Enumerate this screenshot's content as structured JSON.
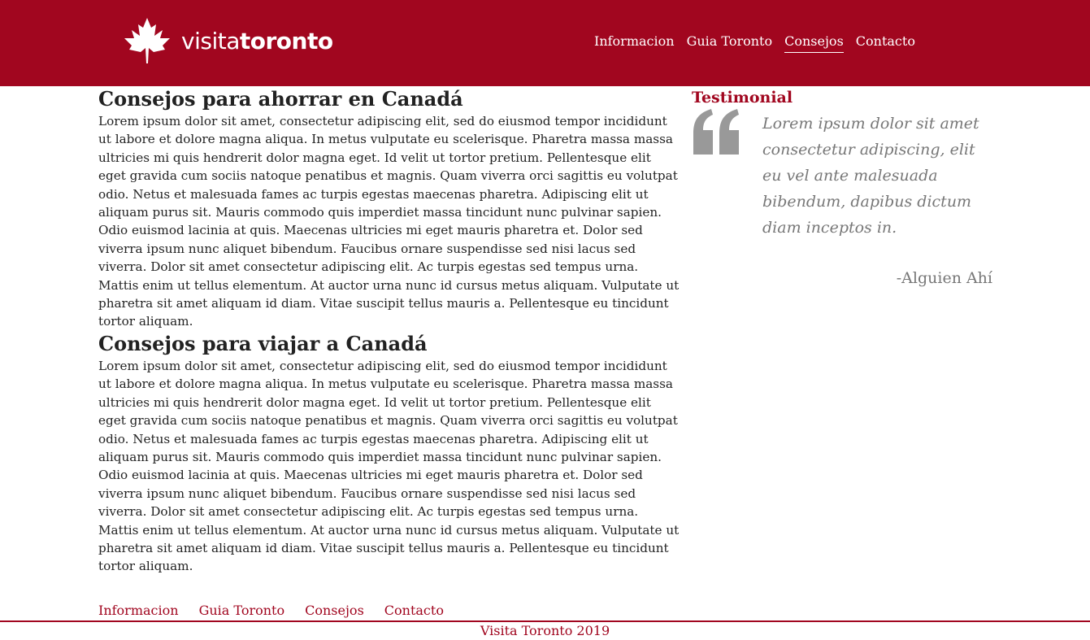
{
  "header": {
    "logo": {
      "icon": "maple-leaf-icon",
      "text_light": "visita",
      "text_bold": "toronto"
    },
    "nav": [
      {
        "label": "Informacion",
        "active": false
      },
      {
        "label": "Guia Toronto",
        "active": false
      },
      {
        "label": "Consejos",
        "active": true
      },
      {
        "label": "Contacto",
        "active": false
      }
    ]
  },
  "main": {
    "sections": [
      {
        "title": "Consejos para ahorrar en Canadá",
        "body": "Lorem ipsum dolor sit amet, consectetur adipiscing elit, sed do eiusmod tempor incididunt ut labore et dolore magna aliqua. In metus vulputate eu scelerisque. Pharetra massa massa ultricies mi quis hendrerit dolor magna eget. Id velit ut tortor pretium. Pellentesque elit eget gravida cum sociis natoque penatibus et magnis. Quam viverra orci sagittis eu volutpat odio. Netus et malesuada fames ac turpis egestas maecenas pharetra. Adipiscing elit ut aliquam purus sit. Mauris commodo quis imperdiet massa tincidunt nunc pulvinar sapien. Odio euismod lacinia at quis. Maecenas ultricies mi eget mauris pharetra et. Dolor sed viverra ipsum nunc aliquet bibendum. Faucibus ornare suspendisse sed nisi lacus sed viverra. Dolor sit amet consectetur adipiscing elit. Ac turpis egestas sed tempus urna. Mattis enim ut tellus elementum. At auctor urna nunc id cursus metus aliquam. Vulputate ut pharetra sit amet aliquam id diam. Vitae suscipit tellus mauris a. Pellentesque eu tincidunt tortor aliquam."
      },
      {
        "title": "Consejos para viajar a Canadá",
        "body": "Lorem ipsum dolor sit amet, consectetur adipiscing elit, sed do eiusmod tempor incididunt ut labore et dolore magna aliqua. In metus vulputate eu scelerisque. Pharetra massa massa ultricies mi quis hendrerit dolor magna eget. Id velit ut tortor pretium. Pellentesque elit eget gravida cum sociis natoque penatibus et magnis. Quam viverra orci sagittis eu volutpat odio. Netus et malesuada fames ac turpis egestas maecenas pharetra. Adipiscing elit ut aliquam purus sit. Mauris commodo quis imperdiet massa tincidunt nunc pulvinar sapien. Odio euismod lacinia at quis. Maecenas ultricies mi eget mauris pharetra et. Dolor sed viverra ipsum nunc aliquet bibendum. Faucibus ornare suspendisse sed nisi lacus sed viverra. Dolor sit amet consectetur adipiscing elit. Ac turpis egestas sed tempus urna. Mattis enim ut tellus elementum. At auctor urna nunc id cursus metus aliquam. Vulputate ut pharetra sit amet aliquam id diam. Vitae suscipit tellus mauris a. Pellentesque eu tincidunt tortor aliquam."
      }
    ]
  },
  "aside": {
    "title": "Testimonial",
    "icon": "quote-icon",
    "quote": "Lorem ipsum dolor sit amet consectetur adipiscing, elit eu vel ante malesuada bibendum, dapibus dictum diam inceptos in.",
    "author": "-Alguien Ahí"
  },
  "footer": {
    "nav": [
      "Informacion",
      "Guia Toronto",
      "Consejos",
      "Contacto"
    ],
    "copyright": "Visita Toronto 2019"
  },
  "colors": {
    "brand": "#a1061f",
    "text": "#222222",
    "muted": "#777777",
    "quote_icon": "#999999"
  }
}
